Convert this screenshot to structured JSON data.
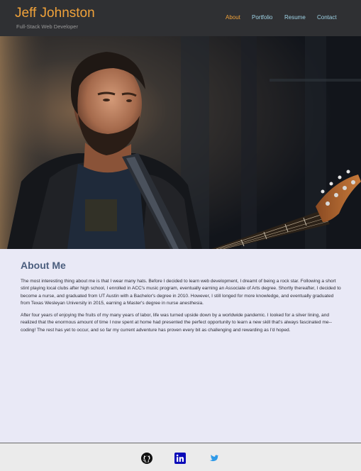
{
  "header": {
    "name": "Jeff Johnston",
    "subtitle": "Full-Stack Web Developer"
  },
  "nav": {
    "items": [
      {
        "label": "About",
        "active": true
      },
      {
        "label": "Portfolio",
        "active": false
      },
      {
        "label": "Resume",
        "active": false
      },
      {
        "label": "Contact",
        "active": false
      }
    ]
  },
  "hero": {
    "subject": "portrait of a man with a guitar"
  },
  "about": {
    "heading": "About Me",
    "paragraphs": [
      "The most interesting thing about me is that I wear many hats. Before I decided to learn web development, I dreamt of being a rock star. Following a short stint playing local clubs after high school, I enrolled in ACC's music program, eventually earning an Associate of Arts degree. Shortly thereafter, I decided to become a nurse, and graduated from UT Austin with a Bachelor's degree in 2010. However, I still longed for more knowledge, and eventually graduated from Texas Wesleyan University in 2015, earning a Master's degree in nurse anesthesia.",
      "After four years of enjoying the fruits of my many years of labor, life was turned upside down by a worldwide pandemic. I looked for a silver lining, and realized that the enormous amount of time I now spent at home had presented the perfect opportunity to learn a new skill that's always fascinated me--coding! The rest has yet to occur, and so far my current adventure has proven every bit as challenging and rewarding as I'd hoped."
    ]
  },
  "footer": {
    "icons": [
      "github-icon",
      "linkedin-icon",
      "twitter-icon"
    ]
  },
  "colors": {
    "accent": "#f0a23a",
    "nav_link": "#9fd3e6",
    "header_bg": "#2f3033",
    "page_bg": "#e9e9f6",
    "heading": "#4b5e7e"
  }
}
